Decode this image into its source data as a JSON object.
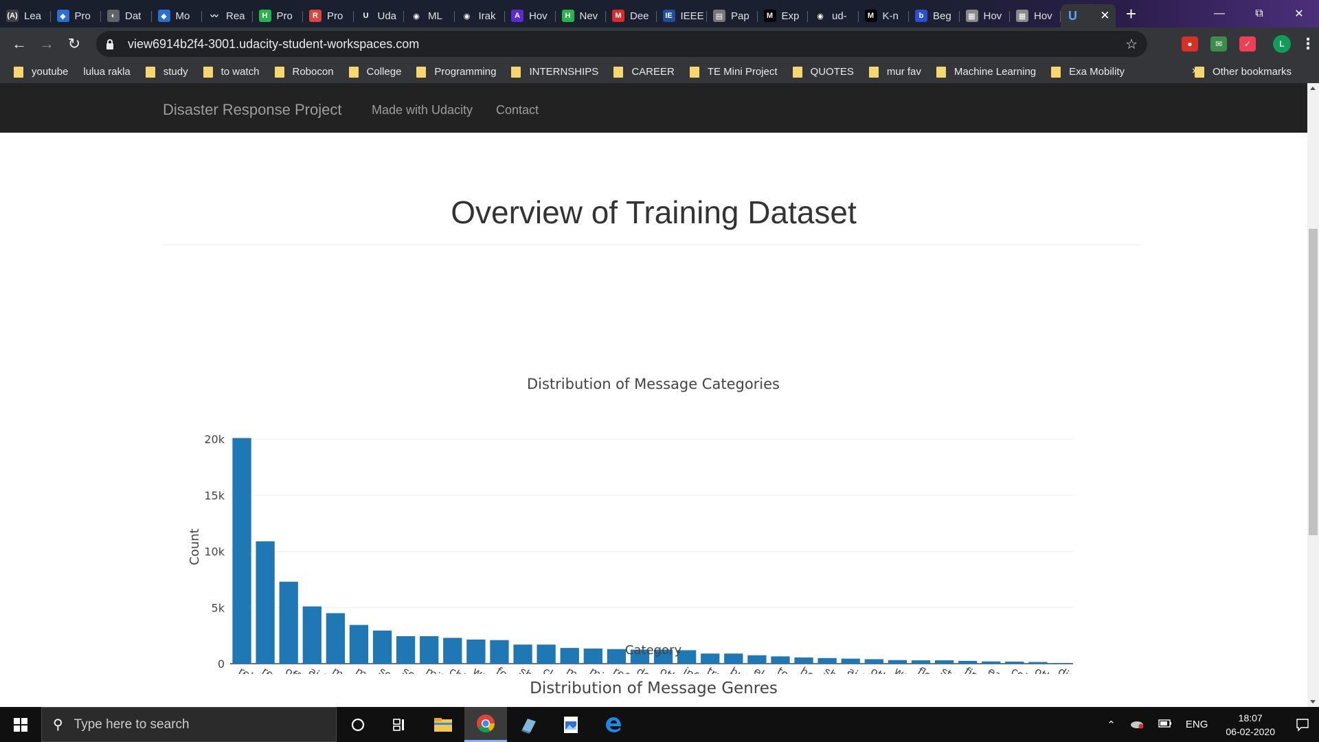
{
  "browser": {
    "tabs": [
      {
        "label": "Lea",
        "fav_color": "#3c4043",
        "fav_text": "(A)"
      },
      {
        "label": "Pro",
        "fav_color": "#2b6fd1",
        "fav_text": "◆"
      },
      {
        "label": "Dat",
        "fav_color": "#5f6368",
        "fav_text": "◐"
      },
      {
        "label": "Mo",
        "fav_color": "#2b6fd1",
        "fav_text": "◆"
      },
      {
        "label": "Rea",
        "fav_color": "#1b2030",
        "fav_text": "〰"
      },
      {
        "label": "Pro",
        "fav_color": "#2bb24c",
        "fav_text": "H"
      },
      {
        "label": "Pro",
        "fav_color": "#d9463e",
        "fav_text": "R"
      },
      {
        "label": "Uda",
        "fav_color": "#1b2030",
        "fav_text": "U"
      },
      {
        "label": "ML",
        "fav_color": "#1b2030",
        "fav_text": "◉"
      },
      {
        "label": "Irak",
        "fav_color": "#1b2030",
        "fav_text": "◉"
      },
      {
        "label": "Hov",
        "fav_color": "#5b2bd1",
        "fav_text": "A"
      },
      {
        "label": "Nev",
        "fav_color": "#2bb24c",
        "fav_text": "H"
      },
      {
        "label": "Dee",
        "fav_color": "#d92b2b",
        "fav_text": "M"
      },
      {
        "label": "IEEE",
        "fav_color": "#1f4e9c",
        "fav_text": "IE"
      },
      {
        "label": "Pap",
        "fav_color": "#777777",
        "fav_text": "▤"
      },
      {
        "label": "Exp",
        "fav_color": "#000000",
        "fav_text": "M"
      },
      {
        "label": "ud-",
        "fav_color": "#1b2030",
        "fav_text": "◉"
      },
      {
        "label": "K-n",
        "fav_color": "#000000",
        "fav_text": "M"
      },
      {
        "label": "Beg",
        "fav_color": "#2b4fd1",
        "fav_text": "b"
      },
      {
        "label": "Hov",
        "fav_color": "#8a8a8a",
        "fav_text": "▦"
      },
      {
        "label": "Hov",
        "fav_color": "#8a8a8a",
        "fav_text": "▦"
      }
    ],
    "active_tab": {
      "fav_color": "#35363a",
      "fav_text": "U"
    },
    "url": "view6914b2f4-3001.udacity-student-workspaces.com",
    "avatar_letter": "L",
    "bookmarks": [
      {
        "label": "youtube",
        "folder": true
      },
      {
        "label": "lulua rakla",
        "folder": false
      },
      {
        "label": "study",
        "folder": true
      },
      {
        "label": "to watch",
        "folder": true
      },
      {
        "label": "Robocon",
        "folder": true
      },
      {
        "label": "College",
        "folder": true
      },
      {
        "label": "Programming",
        "folder": true
      },
      {
        "label": "INTERNSHIPS",
        "folder": true
      },
      {
        "label": "CAREER",
        "folder": true
      },
      {
        "label": "TE Mini Project",
        "folder": true
      },
      {
        "label": "QUOTES",
        "folder": true
      },
      {
        "label": "mur fav",
        "folder": true
      },
      {
        "label": "Machine Learning",
        "folder": true
      },
      {
        "label": "Exa Mobility",
        "folder": true
      }
    ],
    "bookmarks_more": "»",
    "other_bookmarks": "Other bookmarks"
  },
  "app": {
    "brand": "Disaster Response Project",
    "nav_made": "Made with Udacity",
    "nav_contact": "Contact",
    "page_title": "Overview of Training Dataset",
    "genres_title": "Distribution of Message Genres"
  },
  "chart_data": {
    "type": "bar",
    "title": "Distribution of Message Categories",
    "xlabel": "Category",
    "ylabel": "Count",
    "ylim": [
      0,
      20500
    ],
    "yticks": [
      0,
      5000,
      10000,
      15000,
      20000
    ],
    "ytick_labels": [
      "0",
      "5k",
      "10k",
      "15k",
      "20k"
    ],
    "grid": true,
    "color": "#1f77b4",
    "categories": [
      "related",
      "request",
      "offer",
      "aid_related",
      "medical_help",
      "medical_products",
      "search_and_rescue",
      "security",
      "military",
      "child_alone",
      "water",
      "food",
      "shelter",
      "clothing",
      "money",
      "missing_people",
      "refugees",
      "death",
      "other_aid",
      "infrastructure_related",
      "transport",
      "buildings",
      "electricity",
      "tools",
      "hospitals",
      "shops",
      "aid_centers",
      "other_infrastructure",
      "weather_related",
      "floods",
      "storm",
      "fire",
      "earthquake",
      "cold",
      "other_weather",
      "direct_report"
    ],
    "tick_labels": [
      "related",
      "request",
      "offer",
      "aid_related",
      "medical_help",
      "medical_products",
      "search_and_rescue",
      "security",
      "military",
      "child_alone",
      "water",
      "food",
      "shelter",
      "clothing",
      "money",
      "missing_people",
      "refugees",
      "death",
      "other_aid",
      "infrastructure_relate...",
      "transport",
      "buildings",
      "electricity",
      "tools",
      "hospitals",
      "shops",
      "aid_centers",
      "other_infrastructure",
      "weather_related",
      "floods",
      "storm",
      "fire",
      "earthquake",
      "cold",
      "other_weather",
      "direct_report"
    ],
    "values": [
      20100,
      10900,
      7300,
      5100,
      4500,
      3450,
      2950,
      2450,
      2450,
      2300,
      2150,
      2100,
      1700,
      1700,
      1400,
      1350,
      1300,
      1250,
      1250,
      1200,
      900,
      900,
      750,
      650,
      550,
      500,
      450,
      400,
      320,
      300,
      300,
      250,
      200,
      180,
      150,
      60
    ]
  },
  "taskbar": {
    "search_placeholder": "Type here to search",
    "lang": "ENG",
    "time": "18:07",
    "date": "06-02-2020"
  }
}
